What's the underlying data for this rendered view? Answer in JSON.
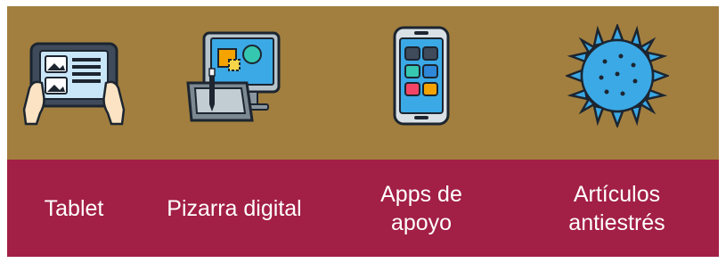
{
  "colors": {
    "top_band": "#a27f3f",
    "bottom_band": "#a21f45",
    "label_text": "#ffffff"
  },
  "items": [
    {
      "label": "Tablet",
      "icon": "tablet-hands-icon"
    },
    {
      "label": "Pizarra digital",
      "icon": "digital-whiteboard-icon"
    },
    {
      "label": "Apps de apoyo",
      "icon": "smartphone-apps-icon"
    },
    {
      "label": "Artículos antiestrés",
      "icon": "stress-ball-icon"
    }
  ]
}
